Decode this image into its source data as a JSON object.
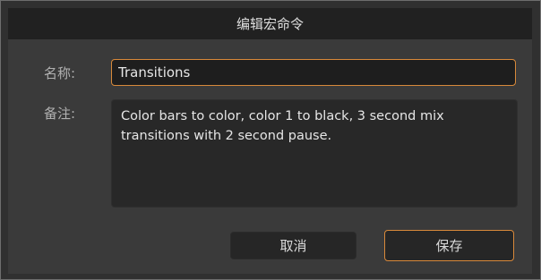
{
  "dialog": {
    "title": "编辑宏命令"
  },
  "form": {
    "name_label": "名称:",
    "name_value": "Transitions",
    "notes_label": "备注:",
    "notes_value": "Color bars to color, color 1 to black, 3 second mix transitions with 2 second pause."
  },
  "buttons": {
    "cancel_label": "取消",
    "save_label": "保存"
  },
  "colors": {
    "accent": "#d8893a",
    "dialog_background": "#3a3a3a",
    "titlebar_background": "#212121"
  }
}
